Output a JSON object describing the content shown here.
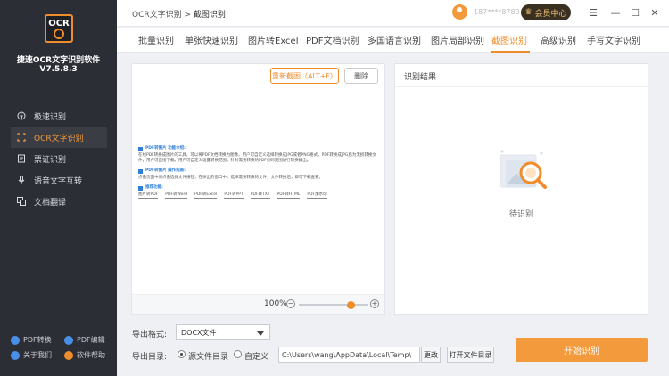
{
  "app": {
    "logo_text": "OCR",
    "name": "捷速OCR文字识别软件",
    "version": "V7.5.8.3"
  },
  "sidebar": {
    "items": [
      {
        "label": "极速识别",
        "icon": "lightning-icon"
      },
      {
        "label": "OCR文字识别",
        "icon": "ocr-scan-icon",
        "active": true
      },
      {
        "label": "票证识别",
        "icon": "receipt-icon"
      },
      {
        "label": "语音文字互转",
        "icon": "microphone-icon"
      },
      {
        "label": "文档翻译",
        "icon": "translate-icon"
      }
    ],
    "bottom_links": [
      {
        "label": "PDF转换",
        "icon": "pdf-convert-icon",
        "color": "#4a8fe7"
      },
      {
        "label": "PDF编辑",
        "icon": "pdf-edit-icon",
        "color": "#4a8fe7"
      },
      {
        "label": "关于我们",
        "icon": "info-icon",
        "color": "#4a8fe7"
      },
      {
        "label": "软件帮助",
        "icon": "help-icon",
        "color": "#f08c2c"
      }
    ]
  },
  "header": {
    "breadcrumb_root": "OCR文字识别",
    "breadcrumb_sep": ">",
    "breadcrumb_current": "截图识别",
    "phone": "187****8789",
    "vip_label": "会员中心",
    "controls": {
      "menu": "☰",
      "minimize": "—",
      "maximize": "☐",
      "close": "✕"
    }
  },
  "tabs": [
    "批量识别",
    "单张快速识别",
    "图片转Excel",
    "PDF文档识别",
    "多国语言识别",
    "图片局部识别",
    "截图识别",
    "高级识别",
    "手写文字识别"
  ],
  "active_tab_index": 6,
  "left_panel": {
    "recapture_label": "重新截图（ALT+F）",
    "delete_label": "删除",
    "doc": {
      "section1_title": "PDF转图片 功能介绍:",
      "section1_text": "在线PDF转换成图片的工具，可以将PDF文档转换为图像，用户可自定义选择转换成JPG或者PNG格式，PDF转换成JPG后为无损转换文件，用户可直接下载。用户可自定义设置转换范围，针对需要转换的PDF页码范围进行转换输出。",
      "section2_title": "PDF转图片 操作指南:",
      "section2_text": "点击页面中间点击选择文件按钮，在弹出的窗口中，选择需要转换的文件，文件转换后，即可下载查看。",
      "section3_title": "推荐功能:",
      "links": [
        "图片转PDF",
        "PDF转Word",
        "PDF转Excel",
        "PDF转PPT",
        "PDF转TXT",
        "PDF转HTML",
        "PDF加水印"
      ]
    },
    "zoom_label": "100%",
    "zoom_value": 0.75
  },
  "right_panel": {
    "title": "识别结果",
    "waiting_label": "待识别"
  },
  "export": {
    "format_label": "导出格式:",
    "format_value": "DOCX文件",
    "dir_label": "导出目录:",
    "radio_source": "源文件目录",
    "radio_custom": "自定义",
    "path_value": "C:\\Users\\wang\\AppData\\Local\\Temp\\",
    "change_label": "更改",
    "open_dir_label": "打开文件目录",
    "start_label": "开始识别"
  },
  "colors": {
    "accent": "#f08c2c",
    "sidebar_bg": "#2b2e35",
    "start_button": "#f39a3c",
    "link_blue": "#2f7fd8"
  }
}
